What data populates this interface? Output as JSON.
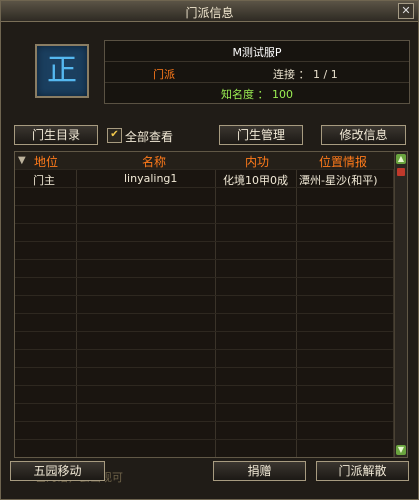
{
  "window": {
    "title": "门派信息",
    "close_label": "✕"
  },
  "emblem": {
    "glyph": "正"
  },
  "info": {
    "server": "M测试服P",
    "faction": "门派",
    "connection": "连接 ： 1 / 1",
    "fame": "知名度 ： 100"
  },
  "controls": {
    "directory_label": "门生目录",
    "view_all_label": "全部查看",
    "view_all_checked": true,
    "manage_label": "门生管理",
    "edit_label": "修改信息"
  },
  "table": {
    "columns": [
      "地位",
      "名称",
      "内功",
      "位置情报"
    ],
    "rows": [
      {
        "rank": "门主",
        "name": "linyaling1",
        "skill": "化境10甲0成",
        "location": "潭州-星沙(和平)"
      }
    ]
  },
  "bottom": {
    "move_label": "五园移动",
    "marquee": "己的话，会出现可",
    "donate_label": "捐赠",
    "disband_label": "门派解散"
  },
  "colors": {
    "accent_orange": "#ff7a1a",
    "fame_green": "#9bef53",
    "text": "#f2ead7"
  }
}
